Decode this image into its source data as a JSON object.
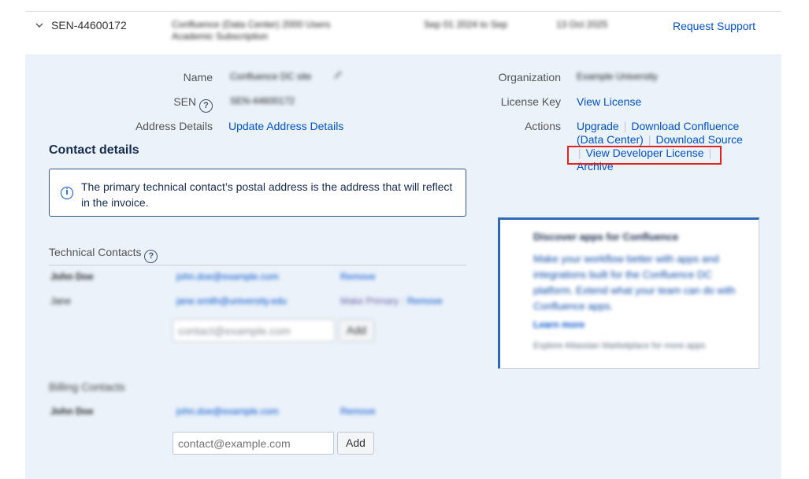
{
  "row": {
    "sen": "SEN-44600172",
    "product": "Confluence (Data Center) 2000 Users",
    "product_line2": "Academic Subscription",
    "date_info": "Sep 01 2024 to Sep",
    "end_date": "13 Oct 2025",
    "request_support": "Request Support"
  },
  "details": {
    "name_label": "Name",
    "name_value": "Confluence DC site",
    "sen_label": "SEN",
    "sen_value": "SEN-44600172",
    "address_label": "Address Details",
    "address_link": "Update Address Details",
    "org_label": "Organization",
    "org_value": "Example University",
    "license_key_label": "License Key",
    "license_key_link": "View License",
    "actions_label": "Actions",
    "actions": {
      "upgrade": "Upgrade",
      "download_confluence": "Download Confluence",
      "data_center": "(Data Center)",
      "download_source": "Download Source",
      "view_dev_license": "View Developer License",
      "archive": "Archive"
    }
  },
  "contact": {
    "heading": "Contact details",
    "info_text": "The primary technical contact’s postal address is the address that will reflect in the invoice.",
    "technical_label": "Technical Contacts",
    "tech_row1": {
      "name": "John Doe",
      "email": "john.doe@example.com",
      "action": "Remove"
    },
    "tech_row2": {
      "name": "Jane",
      "email": "jane.smith@university.edu",
      "make_primary": "Make Primary",
      "remove": "Remove"
    },
    "tech_input_value": "contact@example.com",
    "tech_add": "Add",
    "billing_label": "Billing Contacts",
    "bill_row1": {
      "name": "John Doe",
      "email": "john.doe@example.com",
      "action": "Remove"
    },
    "bill_input_placeholder": "contact@example.com",
    "bill_add": "Add"
  },
  "promo": {
    "title": "Discover apps for Confluence",
    "body": "Make your workflow better with apps and integrations built for the Confluence DC platform. Extend what your team can do with Confluence apps.",
    "link": "Learn more",
    "footer": "Explore Atlassian Marketplace for more apps"
  },
  "colors": {
    "link": "#0052cc",
    "panel": "#ebf2fa",
    "highlight": "#e02424"
  }
}
